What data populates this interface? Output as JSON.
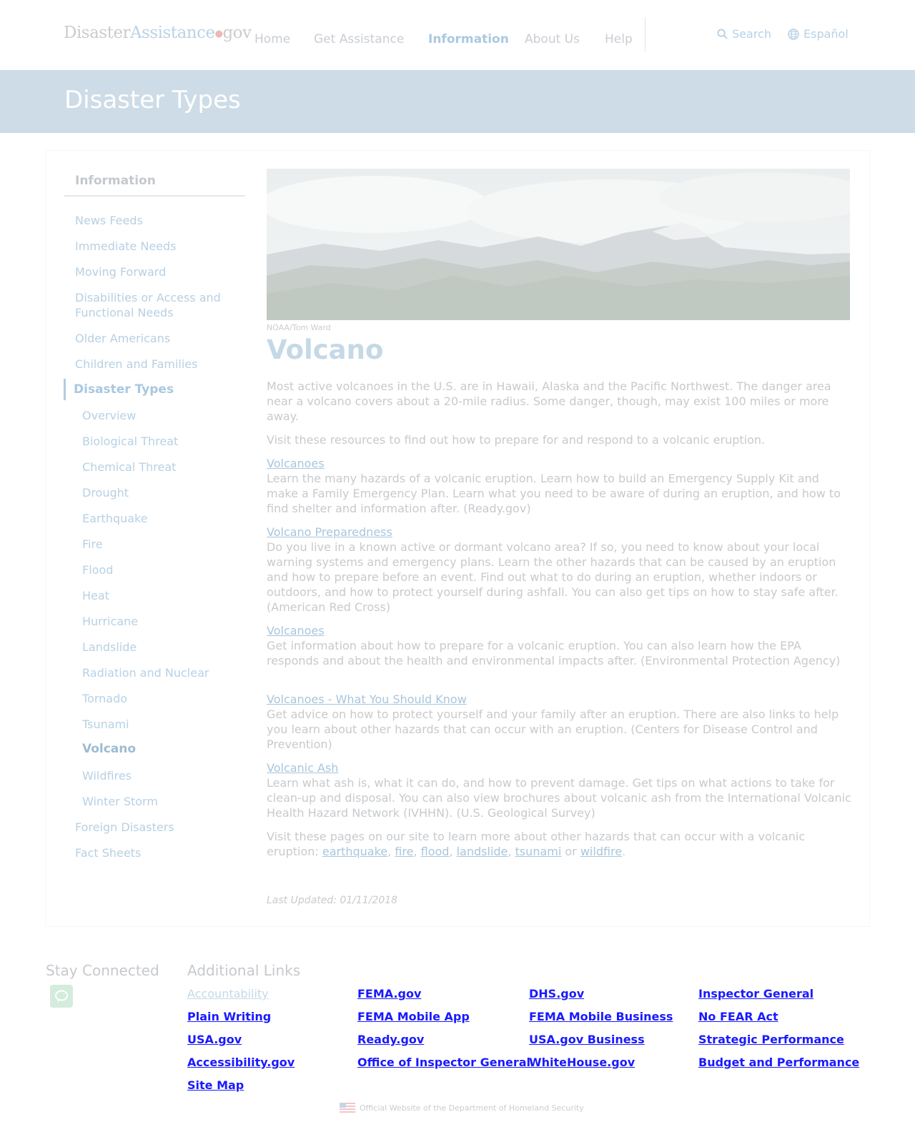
{
  "site": {
    "logo": {
      "part1": "Disaster",
      "part2": "Assistance",
      "dot": "●",
      "part3": "gov"
    }
  },
  "nav": {
    "items": [
      {
        "label": "Home"
      },
      {
        "label": "Get Assistance"
      },
      {
        "label": "Information",
        "active": true
      },
      {
        "label": "About Us"
      },
      {
        "label": "Help"
      }
    ],
    "search_label": "Search",
    "language_label": "Español"
  },
  "banner": {
    "title": "Disaster Types"
  },
  "sidebar": {
    "title": "Information",
    "items": [
      {
        "label": "News Feeds"
      },
      {
        "label": "Immediate Needs"
      },
      {
        "label": "Moving Forward"
      },
      {
        "label": "Disabilities or Access and Functional Needs"
      },
      {
        "label": "Older Americans"
      },
      {
        "label": "Children and Families"
      },
      {
        "label": "Disaster Types",
        "active": true
      },
      {
        "label": "Foreign Disasters"
      },
      {
        "label": "Fact Sheets"
      }
    ],
    "sub_items": [
      {
        "label": "Overview"
      },
      {
        "label": "Biological Threat"
      },
      {
        "label": "Chemical Threat"
      },
      {
        "label": "Drought"
      },
      {
        "label": "Earthquake"
      },
      {
        "label": "Fire"
      },
      {
        "label": "Flood"
      },
      {
        "label": "Heat"
      },
      {
        "label": "Hurricane"
      },
      {
        "label": "Landslide"
      },
      {
        "label": "Radiation and Nuclear"
      },
      {
        "label": "Tornado"
      },
      {
        "label": "Tsunami"
      },
      {
        "label": "Volcano",
        "current": true
      },
      {
        "label": "Wildfires"
      },
      {
        "label": "Winter Storm"
      }
    ]
  },
  "main": {
    "image_credit": "NOAA/Tom Ward",
    "title": "Volcano",
    "intro": "Most active volcanoes in the U.S. are in Hawaii, Alaska and the Pacific Northwest. The danger area near a volcano covers about a 20-mile radius. Some danger, though, may exist 100 miles or more away.",
    "visit": "Visit these resources to find out how to prepare for and respond to a volcanic eruption.",
    "resources": [
      {
        "link": "Volcanoes",
        "text": "Learn the many hazards of a volcanic eruption. Learn how to build an Emergency Supply Kit and make a Family Emergency Plan. Learn what you need to be aware of during an eruption, and how to find shelter and information after. (Ready.gov)"
      },
      {
        "link": "Volcano Preparedness",
        "text": "Do you live in a known active or dormant volcano area? If so, you need to know about your local warning systems and emergency plans. Learn the other hazards that can be caused by an eruption and how to prepare before an event. Find out what to do during an eruption, whether indoors or outdoors, and how to protect yourself during ashfall. You can also get tips on how to stay safe after. (American Red Cross)"
      },
      {
        "link": "Volcanoes",
        "text": "Get information about how to prepare for a volcanic eruption. You can also learn how the EPA responds and about the health and environmental impacts after. (Environmental Protection Agency)"
      },
      {
        "link": "Volcanoes - What You Should Know",
        "text": "Get advice on how to protect yourself and your family after an eruption. There are also links to help you learn about other hazards that can occur with an eruption. (Centers for Disease Control and Prevention)"
      },
      {
        "link": "Volcanic Ash",
        "text": "Learn what ash is, what it can do, and how to prevent damage. Get tips on what actions to take for clean-up and disposal. You can also view brochures about volcanic ash from the International Volcanic Health Hazard Network (IVHHN). (U.S. Geological Survey)"
      }
    ],
    "closing_prefix": "Visit these pages on our site to learn more about other hazards that can occur with a volcanic eruption: ",
    "closing_links": [
      "earthquake",
      "fire",
      "flood",
      "landslide",
      "tsunami",
      "wildfire"
    ],
    "closing_sep": ", ",
    "closing_or": " or ",
    "closing_end": ".",
    "last_updated": "Last Updated: 01/11/2018"
  },
  "footer": {
    "stay_connected": "Stay Connected",
    "additional_links": "Additional Links",
    "links": [
      {
        "label": "Accountability",
        "faded": true
      },
      {
        "label": "FEMA.gov"
      },
      {
        "label": "DHS.gov"
      },
      {
        "label": "Inspector General"
      },
      {
        "label": "Plain Writing"
      },
      {
        "label": "FEMA Mobile App"
      },
      {
        "label": "FEMA Mobile Business"
      },
      {
        "label": "No FEAR Act"
      },
      {
        "label": "USA.gov"
      },
      {
        "label": "Ready.gov"
      },
      {
        "label": "USA.gov Business"
      },
      {
        "label": "Strategic Performance"
      },
      {
        "label": "Accessibility.gov"
      },
      {
        "label": "Office of Inspector General"
      },
      {
        "label": "WhiteHouse.gov"
      },
      {
        "label": "Budget and Performance"
      },
      {
        "label": "Site Map"
      }
    ],
    "official": "Official Website of the Department of Homeland Security"
  },
  "colors": {
    "accent": "#a9c9e0",
    "banner": "#cddce6",
    "footer_link": "#1a1aff"
  },
  "icons": [
    "search-icon",
    "globe-icon",
    "chat-icon",
    "us-flag-icon"
  ]
}
